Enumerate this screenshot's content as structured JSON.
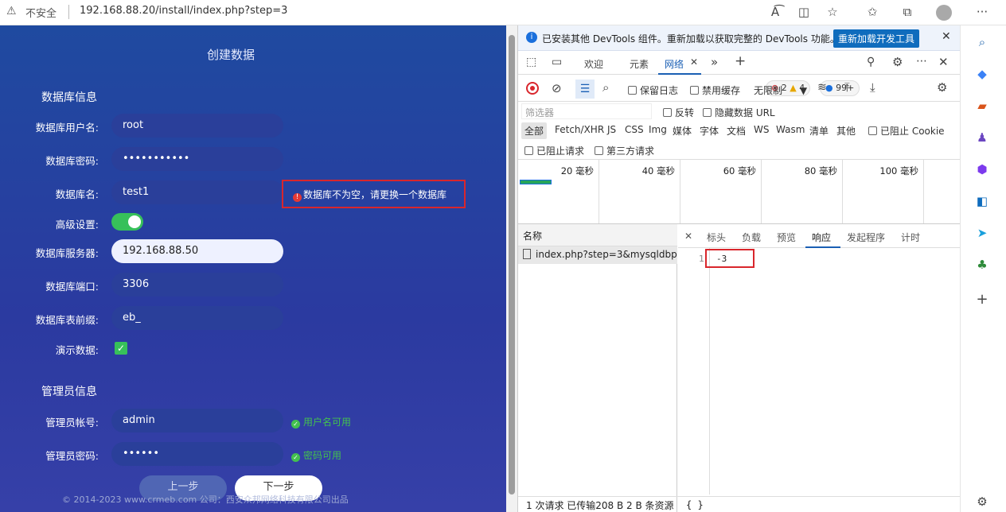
{
  "browser": {
    "insecure_label": "不安全",
    "url": "192.168.88.20/install/index.php?step=3"
  },
  "page": {
    "title": "创建数据",
    "db_section": "数据库信息",
    "fields": [
      {
        "label": "数据库用户名:",
        "value": "root"
      },
      {
        "label": "数据库密码:",
        "value": "•••••••••••"
      },
      {
        "label": "数据库名:",
        "value": "test1"
      },
      {
        "label": "高级设置:",
        "value": ""
      },
      {
        "label": "数据库服务器:",
        "value": "192.168.88.50"
      },
      {
        "label": "数据库端口:",
        "value": "3306"
      },
      {
        "label": "数据库表前缀:",
        "value": "eb_"
      },
      {
        "label": "演示数据:",
        "value": ""
      }
    ],
    "db_error": "数据库不为空，请更换一个数据库",
    "admin_section": "管理员信息",
    "admin_fields": [
      {
        "label": "管理员帐号:",
        "value": "admin",
        "status": "用户名可用"
      },
      {
        "label": "管理员密码:",
        "value": "••••••",
        "status": "密码可用"
      }
    ],
    "prev_button": "上一步",
    "next_button": "下一步",
    "copyright": "© 2014-2023 www.crmeb.com 公司：西安众邦网络科技有限公司出品"
  },
  "devtools": {
    "info_text": "已安装其他 DevTools 组件。重新加载以获取完整的 DevTools 功能。",
    "info_button": "重新加载开发工具",
    "tabs": [
      "欢迎",
      "元素",
      "网络"
    ],
    "errors": "2",
    "warnings": "4",
    "messages": "99+",
    "preserve_log": "保留日志",
    "disable_cache": "禁用缓存",
    "throttle": "无限制",
    "filter_placeholder": "筛选器",
    "invert": "反转",
    "hide_data_urls": "隐藏数据 URL",
    "type_filters": [
      "全部",
      "Fetch/XHR",
      "JS",
      "CSS",
      "Img",
      "媒体",
      "字体",
      "文档",
      "WS",
      "Wasm",
      "清单",
      "其他"
    ],
    "blocked_cookies": "已阻止 Cookie",
    "blocked_requests": "已阻止请求",
    "third_party": "第三方请求",
    "timeline_ticks": [
      "20 毫秒",
      "40 毫秒",
      "60 毫秒",
      "80 毫秒",
      "100 毫秒"
    ],
    "name_header": "名称",
    "request_name": "index.php?step=3&mysqldbp...",
    "detail_tabs": [
      "标头",
      "负载",
      "预览",
      "响应",
      "发起程序",
      "计时"
    ],
    "line_number": "1",
    "response_body": "-3",
    "status_bar": "1 次请求  已传输208 B  2 B 条资源",
    "braces": "{ }"
  }
}
